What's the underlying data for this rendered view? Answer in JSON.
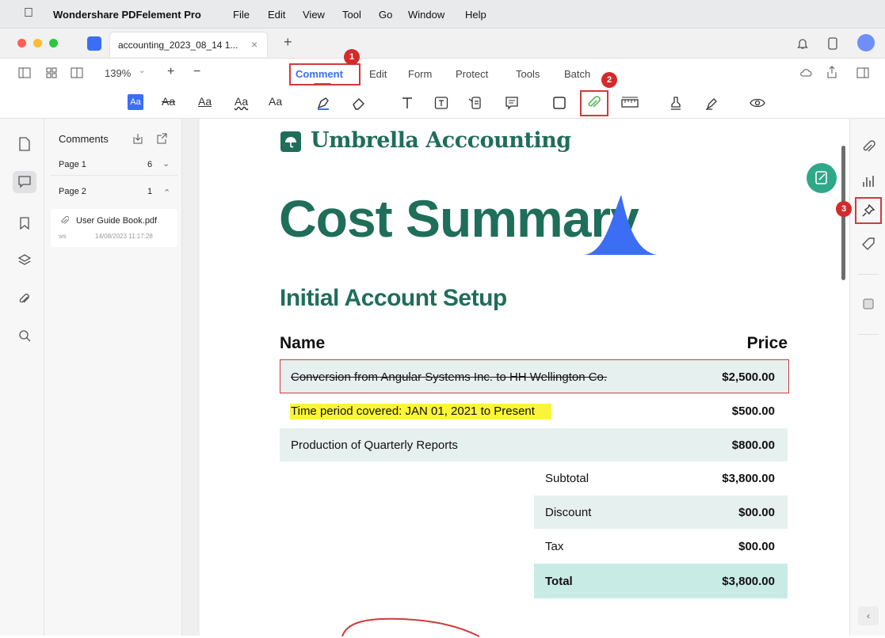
{
  "menubar": {
    "app": "Wondershare PDFelement Pro",
    "items": [
      "File",
      "Edit",
      "View",
      "Tool",
      "Go",
      "Window",
      "Help"
    ]
  },
  "tab": {
    "title": "accounting_2023_08_14 1...",
    "close": "×",
    "new": "+"
  },
  "toolbar": {
    "zoom": "139%",
    "zoom_plus": "+",
    "zoom_minus": "−",
    "tabs": [
      "Comment",
      "Edit",
      "Form",
      "Protect",
      "Tools",
      "Batch"
    ],
    "active_tab": "Comment"
  },
  "text_tools": [
    "Aa",
    "Aa",
    "Aa",
    "Aa",
    "Aa"
  ],
  "badges": [
    "1",
    "2",
    "3"
  ],
  "comments_panel": {
    "title": "Comments",
    "page1": {
      "label": "Page 1",
      "count": "6"
    },
    "page2": {
      "label": "Page 2",
      "count": "1"
    },
    "item": {
      "name": "User Guide Book.pdf",
      "author": "ws",
      "date": "14/08/2023 11:17:28"
    }
  },
  "document": {
    "brand": "Umbrella Acccounting",
    "title": "Cost Summary",
    "section": "Initial Account Setup",
    "col_name": "Name",
    "col_price": "Price",
    "rows": [
      {
        "name": "Conversion from Angular Systems Inc. to HH Wellington Co.",
        "price": "$2,500.00"
      },
      {
        "name": "Time period covered: JAN 01, 2021 to Present",
        "price": "$500.00"
      },
      {
        "name": "Production of Quarterly Reports",
        "price": "$800.00"
      }
    ],
    "totals": [
      {
        "label": "Subtotal",
        "value": "$3,800.00"
      },
      {
        "label": "Discount",
        "value": "$00.00"
      },
      {
        "label": "Tax",
        "value": "$00.00"
      },
      {
        "label": "Total",
        "value": "$3,800.00"
      }
    ]
  },
  "colors": {
    "brand": "#1f6e5a",
    "accent": "#3b6ef5",
    "highlight": "#fbf53a",
    "annotation_red": "#d23a3a",
    "row_shade": "#e6f0ee",
    "total_shade": "#c9ebe6"
  }
}
